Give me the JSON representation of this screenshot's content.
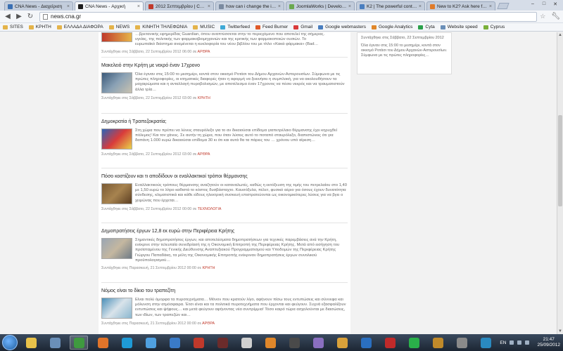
{
  "tabs": [
    {
      "label": "CNA News - Διαχείριση",
      "color": "#3a6fb3",
      "active": false
    },
    {
      "label": "CNA News - Αρχική",
      "color": "#1d1d1d",
      "active": true
    },
    {
      "label": "2012 Σεπτεμβρίου | CNA",
      "color": "#c0392b",
      "active": false
    },
    {
      "label": "how can i change the im…",
      "color": "#7a8aa0",
      "active": false
    },
    {
      "label": "JoomlaWorks | Develope…",
      "color": "#6aa84f",
      "active": false
    },
    {
      "label": "K2 | The powerful conte…",
      "color": "#4a7ebf",
      "active": false
    },
    {
      "label": "New to K2? Ask here first…",
      "color": "#e07b2a",
      "active": false
    }
  ],
  "address": {
    "url": "news.cna.gr"
  },
  "bookmarks": [
    {
      "label": "SITES",
      "icon": "folder"
    },
    {
      "label": "ΚΡΗΤΗ",
      "icon": "folder"
    },
    {
      "label": "ΕΛΛΑΔΑ ΔΙΑΦΟΡΑ",
      "icon": "folder"
    },
    {
      "label": "NEWS",
      "icon": "folder"
    },
    {
      "label": "ΚΙΝΗΤΗ ΤΗΛΕΦΩΝΙΑ",
      "icon": "folder"
    },
    {
      "label": "MUSIC",
      "icon": "folder"
    },
    {
      "label": "Twitterfeed",
      "icon": "twitterfeed"
    },
    {
      "label": "Feed Burner",
      "icon": "feedburner"
    },
    {
      "label": "Gmail",
      "icon": "gmail"
    },
    {
      "label": "Google webmasters",
      "icon": "google"
    },
    {
      "label": "Google Analytics",
      "icon": "analytics"
    },
    {
      "label": "Cyta",
      "icon": "cyta"
    },
    {
      "label": "Website speed",
      "icon": "speed"
    },
    {
      "label": "Cyprus",
      "icon": "cyprus"
    }
  ],
  "top_snippet": {
    "line1": "…βρετανικής εφημερίδας Guardian, όπου αναπτύσσεται στην το περιεχόμενο που αποτελεί της σήμερας.",
    "line2": "υγείας, της πολιτικής των φαρμακοβιομηχανιών και της κριτικής των φαρμακοποιών ουσιών. Το",
    "line3": "ευρωπαϊκό διάστημα αναμένεται η κυκλοφορία του νέου βιβλίου του με τίτλο «Κακά φάρμακα» (Bad…",
    "meta": "Συντάχθηκε στις Σάββατο, 22 Σεπτεμβρίου 2012 06:00 σε",
    "category": "ΑΡΘΡΑ"
  },
  "articles": [
    {
      "title": "Μακελειό στην Κρήτη με νεκρό έναν 17χρονο",
      "excerpt": "Όλα έγιναν στις 15:00 το μεσημέρι, κοντά στον οικισμό Ροτάσι του Δήμου Αρχανών-Αστερουσίων. Σύμφωνα με τις πρώτες πληροφορίες, οι κτηματικές διαφορές ήταν η αφορμή να ξεκινήσει η συμπλοκή, για να ακολουθήσουν τα μαχαιρώματα και η ανταλλαγή πυροβολισμών, με αποτέλεσμα έναν 17χρονος να πέσει νεκρός και να τραυματιστούν άλλα τρία…",
      "meta": "Συντάχθηκε στις Σάββατο, 22 Σεπτεμβρίου 2012 03:00 σε",
      "category": "ΚΡΗΤΗ",
      "thumb_colors": [
        "#3b5a7a",
        "#8aa1b5",
        "#c9c2b0"
      ]
    },
    {
      "title": "Δημοκρατία ή Τραπεζοκρατία;",
      "excerpt": "Στη χώρα που πρέπει να λύνεις σταυρόλεξο για το αν δικαιούσαι επίδομα γιαπετρέλαιο θέρμανσης έχει κηρυχθεί πόλεμος! Και τον χάνεις. Σε αυτήν τη χώρα, που όταν λύσεις αυτό το ποταπό σταυρόλεξο, διαπιστώνεις ότι για δαπάνη 1.000 ευρώ δικαιούσαι επίδομα 30 κι ότι και αυτά θα τα πάρεις του … χρόνου υπό αίρεση…",
      "meta": "Συντάχθηκε στις Σάββατο, 22 Σεπτεμβρίου 2012 03:00 σε",
      "category": "ΑΡΘΡΑ",
      "thumb_colors": [
        "#2a64b8",
        "#d93b3b",
        "#e8d24a"
      ]
    },
    {
      "title": "Πόσο κοστίζουν και τι αποδίδουν οι εναλλακτικοί τρόποι θέρμανσης",
      "excerpt": "Εναλλακτικούς τρόπους θέρμανσης αναζητούν οι καταναλωτές, καθώς η εκτόξευση της τιμής του πετρελαίου στο 1,40 με 1,50 ευρώ το λίτρο καθιστά το κόστος δυσβάσταχτο. Καυσόξυλα, πέλετ, φυσικό αέριο για όσους έχουν δυνατότητα σύνδεσης, κλιματιστικά και κάθε είδους ηλεκτρική συσκευή επιστρατεύονται ως οικονομικότερες λύσεις για να βγει ο χειμώνας που έρχεται…",
      "meta": "Συντάχθηκε στις Σάββατο, 22 Σεπτεμβρίου 2012 00:00 σε",
      "category": "ΤΕΧΝΟΛΟΓΙΑ",
      "thumb_colors": [
        "#7a5a34",
        "#a7834f",
        "#5c3f22"
      ]
    },
    {
      "title": "Δημοπρατήσεις έργων 12,8 εκ ευρώ στην Περιφέρεια Κρήτης",
      "excerpt": "Σημαντικές δημοπρατήσεις έργων, και αποτελέσματα δημοπρατήσεων για τεχνικές παρεμβάσεις ανά την Κρήτη, ενέκρινε στην τελευταία συνεδρίασή της η Οικονομική Επιτροπή της Περιφέρειας Κρήτης. Μετά από εισήγηση του προϊσταμένου της Γενικής Διεύθυνσης Αναπτυξιακού Προγραμματισμού και Υποδομών της Περιφέρειας Κρήτης Γιώργου Παπαδάκη, τα μέλη της Οικονομικής Επιτροπής ενέκριναν δημοπρατήσεις έργων συνολικού προϋπολογισμού…",
      "meta": "Συντάχθηκε στις Παρασκευή, 21 Σεπτεμβρίου 2012 00:00 σε",
      "category": "ΚΡΗΤΗ",
      "thumb_colors": [
        "#9aa6b3",
        "#c4b7a0",
        "#6f7b86"
      ]
    },
    {
      "title": "Νόμος είναι το δίκιο του τραπεζίτη",
      "excerpt": "Είναι πολύ όμορφα τα πυροτεχνήματα… Μόνον που κρατούν λίγο, αφήνουν πίσω τους εντυπώσεις και σύννεφα και μόλυνση στην ατμόσφαιρα. Έτσι είναι και τα πολιτικά πυροτεχνήματα που έρχονται και φεύγουν. Συχνά εξασφαλίζουν εντυπώσεις και ψήφους… και μετά φεύγουν αφήνοντας νέα συντρίμμια! Τόσο καιρό τώρα ασχολούνται με διασώσεις, των ιδίων, των τραπεζών και…",
      "meta": "Συντάχθηκε στις Παρασκευή, 21 Σεπτεμβρίου 2012 00:00 σε",
      "category": "ΑΡΘΡΑ",
      "thumb_colors": [
        "#4a8fb8",
        "#d9e3ea",
        "#8bb7cf"
      ]
    }
  ],
  "sidebar": {
    "meta": "Συντάχθηκε στις Σάββατο, 22 Σεπτεμβρίου 2012",
    "excerpt": "Όλα έγιναν στις 15:00 το μεσημέρι, κοντά στον οικισμό Ροτάσι του Δήμου Αρχανών-Αστερουσίων. Σύμφωνα με τις πρώτες πληροφορίες…"
  },
  "taskbar": {
    "apps": [
      {
        "name": "explorer-app-icon",
        "color": "#e8c24a",
        "active": false
      },
      {
        "name": "gallery-app-icon",
        "color": "#6a8fb8",
        "active": false
      },
      {
        "name": "chrome-app-icon",
        "color": "#3f9a3f",
        "active": true
      },
      {
        "name": "firefox-app-icon",
        "color": "#e0742a",
        "active": false
      },
      {
        "name": "skype-app-icon",
        "color": "#1e9ad6",
        "active": false
      },
      {
        "name": "itunes-app-icon",
        "color": "#4fa0e0",
        "active": false
      },
      {
        "name": "app-icon",
        "color": "#3a7bc8",
        "active": false
      },
      {
        "name": "filezilla-app-icon",
        "color": "#c0392b",
        "active": false
      },
      {
        "name": "app-icon",
        "color": "#6b2b2b",
        "active": false
      },
      {
        "name": "app-icon",
        "color": "#d0d0d0",
        "active": false
      },
      {
        "name": "app-icon",
        "color": "#e0872a",
        "active": false
      },
      {
        "name": "app-icon",
        "color": "#4a4a4a",
        "active": false
      },
      {
        "name": "app-icon",
        "color": "#8a6fc0",
        "active": false
      },
      {
        "name": "app-icon",
        "color": "#d9a13a",
        "active": false
      },
      {
        "name": "app-icon",
        "color": "#2a6fc0",
        "active": false
      },
      {
        "name": "app-icon",
        "color": "#c02a2a",
        "active": false
      },
      {
        "name": "app-icon",
        "color": "#2ab04a",
        "active": false
      },
      {
        "name": "app-icon",
        "color": "#c08a2a",
        "active": false
      },
      {
        "name": "app-icon",
        "color": "#8a8a8a",
        "active": false
      },
      {
        "name": "app-icon",
        "color": "#2a8ac0",
        "active": false
      }
    ],
    "lang": "EN",
    "time": "21:47",
    "date": "25/09/2012"
  }
}
